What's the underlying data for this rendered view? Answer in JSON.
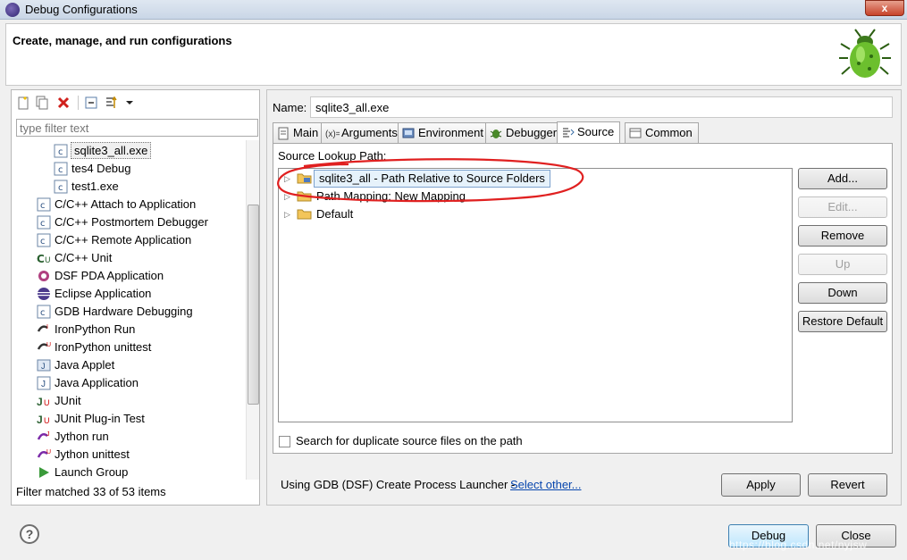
{
  "window": {
    "title": "Debug Configurations",
    "close_glyph": "x"
  },
  "header": {
    "title": "Create, manage, and run configurations",
    "icon": "bug-icon"
  },
  "left": {
    "filter_placeholder": "type filter text",
    "tree": [
      {
        "label": "sqlite3_all.exe",
        "icon": "c-config-icon",
        "indent": 2,
        "selected": true
      },
      {
        "label": "tes4 Debug",
        "icon": "c-config-icon",
        "indent": 2
      },
      {
        "label": "test1.exe",
        "icon": "c-config-icon",
        "indent": 2
      },
      {
        "label": "C/C++ Attach to Application",
        "icon": "c-app-icon",
        "indent": 1
      },
      {
        "label": "C/C++ Postmortem Debugger",
        "icon": "c-app-icon",
        "indent": 1
      },
      {
        "label": "C/C++ Remote Application",
        "icon": "c-app-icon",
        "indent": 1
      },
      {
        "label": "C/C++ Unit",
        "icon": "c-unit-icon",
        "indent": 1
      },
      {
        "label": "DSF PDA Application",
        "icon": "pda-icon",
        "indent": 1
      },
      {
        "label": "Eclipse Application",
        "icon": "eclipse-icon",
        "indent": 1
      },
      {
        "label": "GDB Hardware Debugging",
        "icon": "c-app-icon",
        "indent": 1
      },
      {
        "label": "IronPython Run",
        "icon": "ironpython-icon",
        "indent": 1
      },
      {
        "label": "IronPython unittest",
        "icon": "ironpython-unittest-icon",
        "indent": 1
      },
      {
        "label": "Java Applet",
        "icon": "java-applet-icon",
        "indent": 1
      },
      {
        "label": "Java Application",
        "icon": "java-app-icon",
        "indent": 1
      },
      {
        "label": "JUnit",
        "icon": "junit-icon",
        "indent": 1
      },
      {
        "label": "JUnit Plug-in Test",
        "icon": "junit-plugin-icon",
        "indent": 1
      },
      {
        "label": "Jython run",
        "icon": "jython-icon",
        "indent": 1
      },
      {
        "label": "Jython unittest",
        "icon": "jython-unittest-icon",
        "indent": 1
      },
      {
        "label": "Launch Group",
        "icon": "launch-group-icon",
        "indent": 1
      }
    ],
    "status": "Filter matched 33 of 53 items"
  },
  "right": {
    "name_label": "Name:",
    "name_value": "sqlite3_all.exe",
    "tabs": [
      {
        "label": "Main",
        "icon": "main-tab-icon"
      },
      {
        "label": "Arguments",
        "icon": "arguments-tab-icon"
      },
      {
        "label": "Environment",
        "icon": "environment-tab-icon"
      },
      {
        "label": "Debugger",
        "icon": "debugger-tab-icon"
      },
      {
        "label": "Source",
        "icon": "source-tab-icon",
        "active": true
      },
      {
        "label": "Common",
        "icon": "common-tab-icon"
      }
    ],
    "source": {
      "label": "Source Lookup Path:",
      "nodes": [
        {
          "label": "sqlite3_all - Path Relative to Source Folders",
          "selected": true
        },
        {
          "label": "Path Mapping: New Mapping"
        },
        {
          "label": "Default"
        }
      ],
      "buttons": [
        {
          "label": "Add...",
          "enabled": true
        },
        {
          "label": "Edit...",
          "enabled": false
        },
        {
          "label": "Remove",
          "enabled": true
        },
        {
          "label": "Up",
          "enabled": false
        },
        {
          "label": "Down",
          "enabled": true
        },
        {
          "label": "Restore Default",
          "enabled": true
        }
      ],
      "dup_label": "Search for duplicate source files on the path",
      "dup_checked": false
    },
    "launcher_text": "Using GDB (DSF) Create Process Launcher -",
    "launcher_link": "Select other...",
    "apply": "Apply",
    "revert": "Revert"
  },
  "footer": {
    "help_glyph": "?",
    "debug": "Debug",
    "close": "Close",
    "watermark": "https://blog.csdn.net/nyjsw"
  },
  "colors": {
    "annotation": "#e02020",
    "link": "#0645ad"
  }
}
